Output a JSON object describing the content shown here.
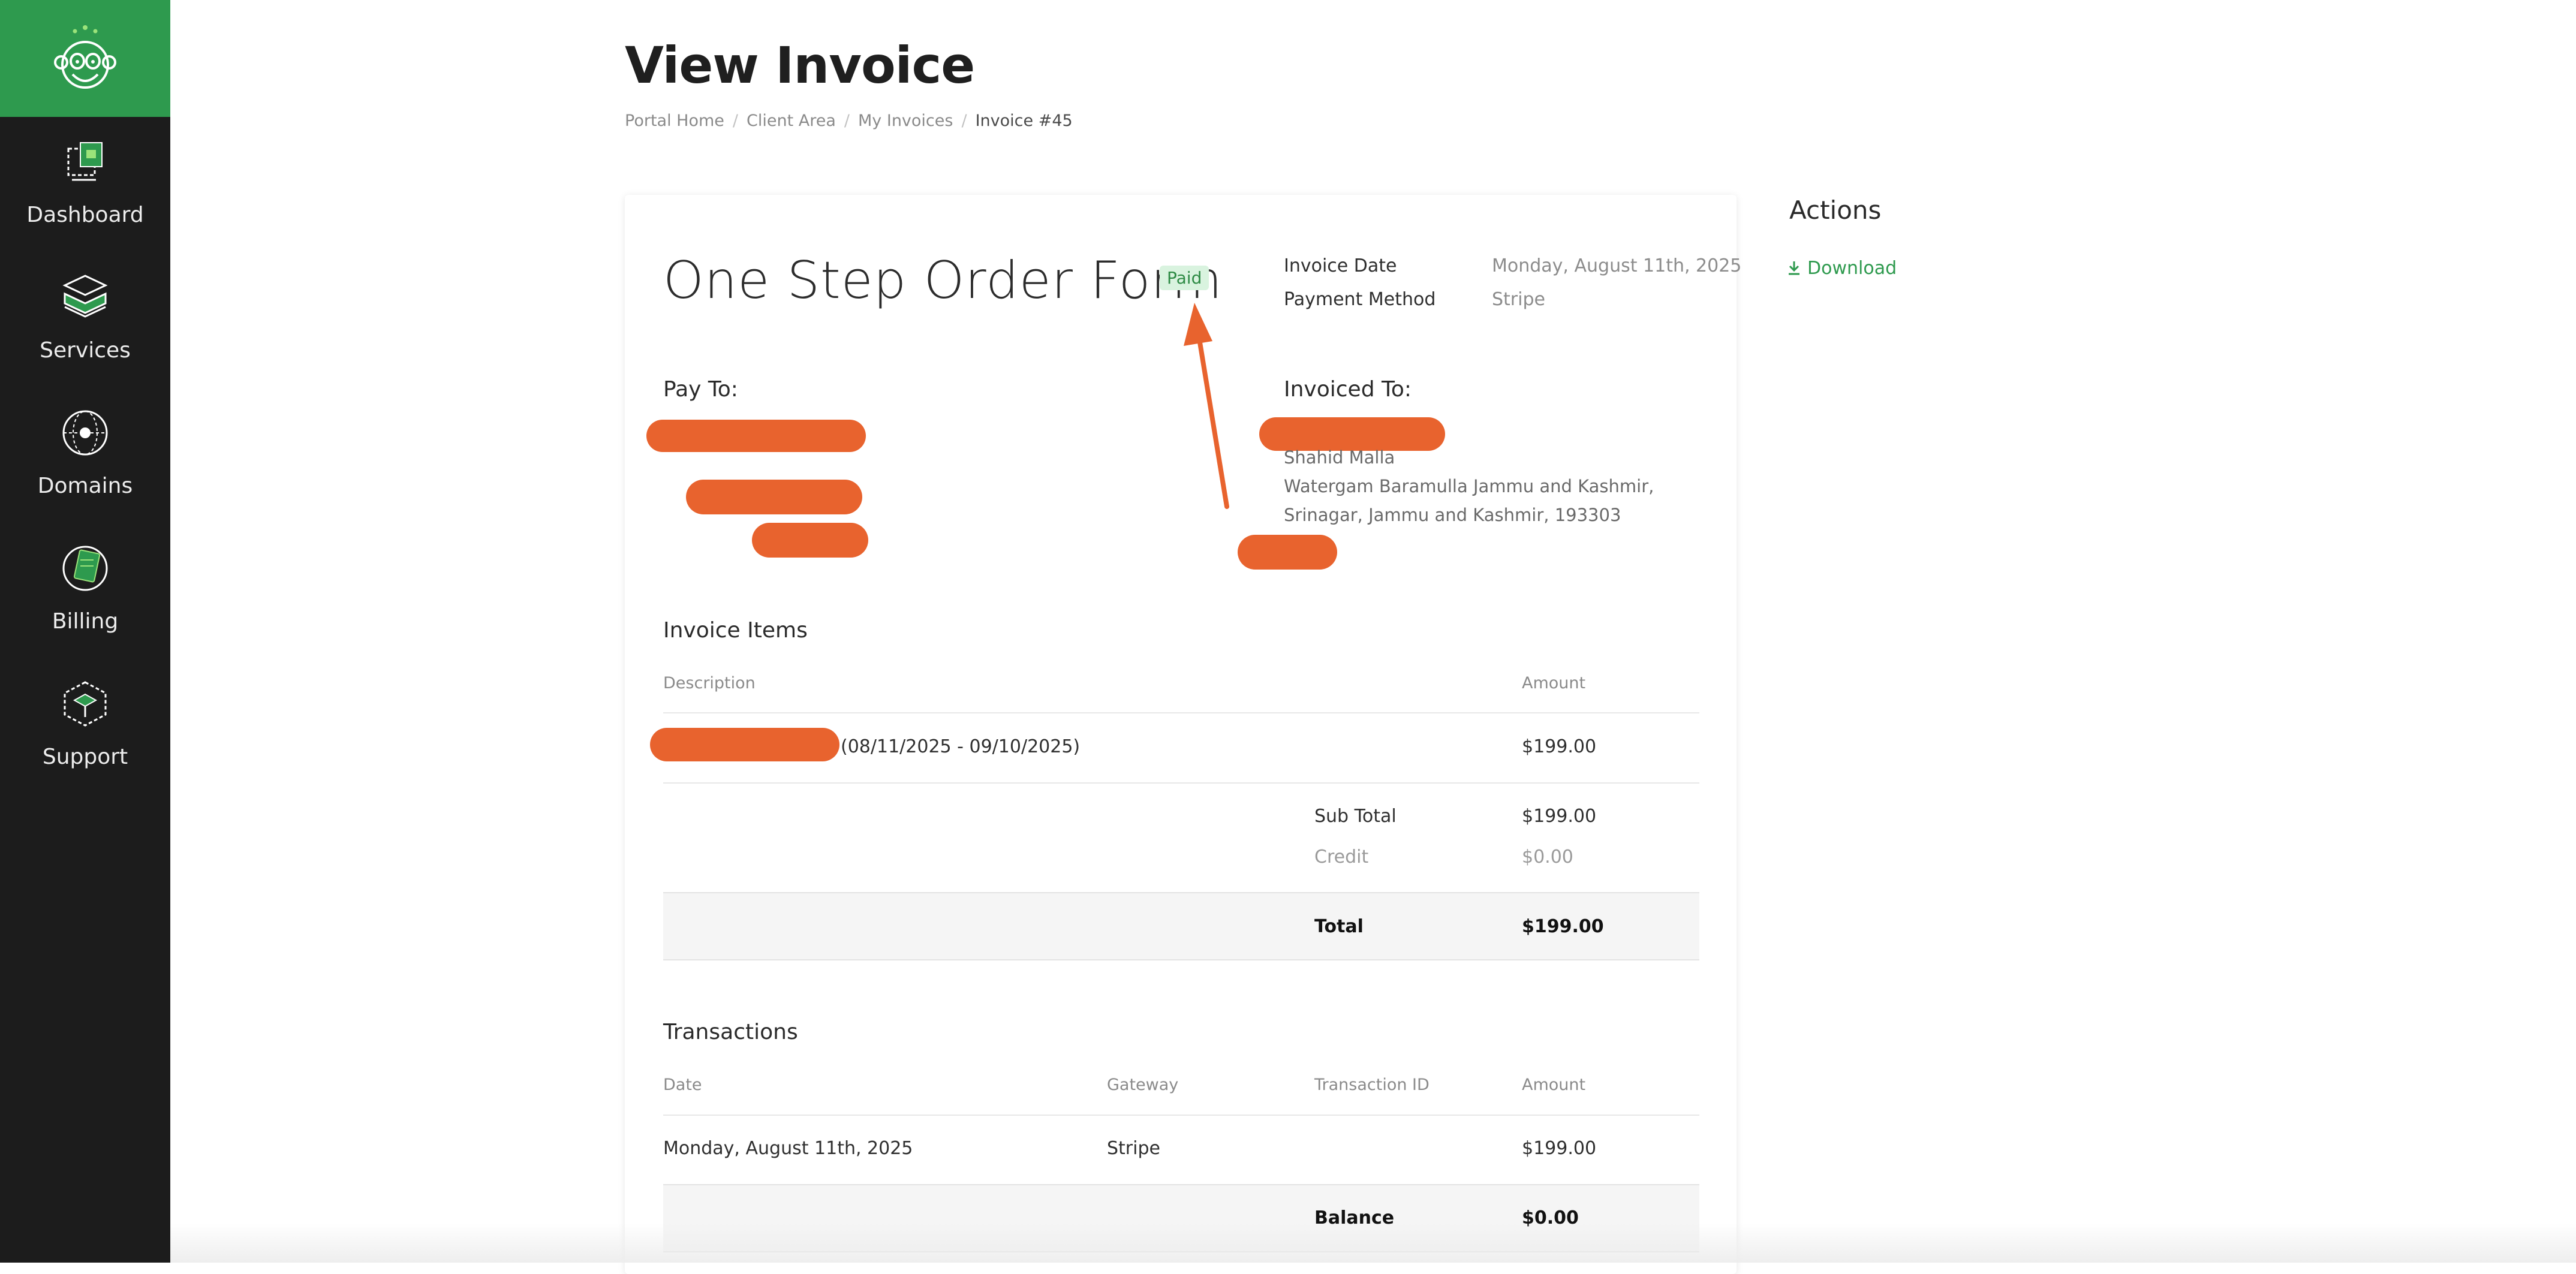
{
  "sidebar": {
    "items": [
      {
        "label": "Dashboard",
        "icon": "dashboard-icon"
      },
      {
        "label": "Services",
        "icon": "services-icon"
      },
      {
        "label": "Domains",
        "icon": "domains-icon"
      },
      {
        "label": "Billing",
        "icon": "billing-icon"
      },
      {
        "label": "Support",
        "icon": "support-icon"
      }
    ],
    "logo_icon": "monkey-logo-icon"
  },
  "page": {
    "title": "View Invoice",
    "breadcrumb": [
      "Portal Home",
      "Client Area",
      "My Invoices",
      "Invoice #45"
    ]
  },
  "invoice": {
    "title": "One Step Order Form",
    "status": "Paid",
    "meta": {
      "date_label": "Invoice Date",
      "date_value": "Monday, August 11th, 2025",
      "method_label": "Payment Method",
      "method_value": "Stripe"
    },
    "pay_to_label": "Pay To:",
    "invoiced_to_label": "Invoiced To:",
    "invoiced_to": {
      "name": "Shahid Malla",
      "address_line1": "Watergam Baramulla Jammu and Kashmir,",
      "address_line2": "Srinagar, Jammu and Kashmir, 193303"
    }
  },
  "items": {
    "heading": "Invoice Items",
    "col_description": "Description",
    "col_amount": "Amount",
    "rows": [
      {
        "description": "(08/11/2025 - 09/10/2025)",
        "amount": "$199.00"
      }
    ],
    "subtotal_label": "Sub Total",
    "subtotal_value": "$199.00",
    "credit_label": "Credit",
    "credit_value": "$0.00",
    "total_label": "Total",
    "total_value": "$199.00"
  },
  "transactions": {
    "heading": "Transactions",
    "col_date": "Date",
    "col_gateway": "Gateway",
    "col_txid": "Transaction ID",
    "col_amount": "Amount",
    "rows": [
      {
        "date": "Monday, August 11th, 2025",
        "gateway": "Stripe",
        "txid": "",
        "amount": "$199.00"
      }
    ],
    "balance_label": "Balance",
    "balance_value": "$0.00"
  },
  "actions": {
    "title": "Actions",
    "download_label": "Download",
    "download_icon": "download-icon"
  },
  "colors": {
    "accent": "#2e9a4e",
    "sidebar_bg": "#1c1c1c",
    "redaction": "#e8632e",
    "paid_badge_bg": "#d9f3df"
  }
}
